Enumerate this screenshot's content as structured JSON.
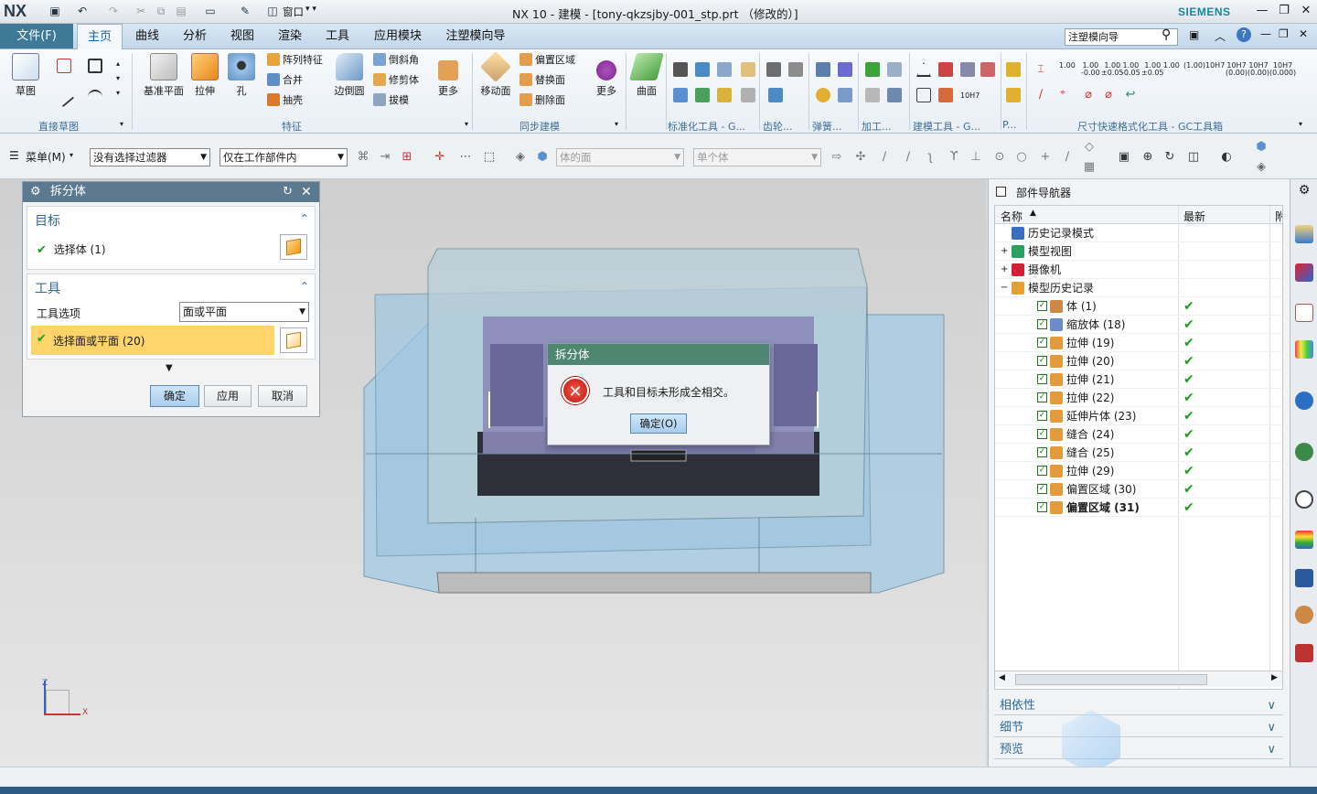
{
  "app": {
    "logo": "NX",
    "title": "NX 10 - 建模 - [tony-qkzsjby-001_stp.prt （修改的）]",
    "brand": "SIEMENS",
    "window_menu": "窗口"
  },
  "tabs": {
    "file": "文件(F)",
    "items": [
      "主页",
      "曲线",
      "分析",
      "视图",
      "渲染",
      "工具",
      "应用模块",
      "注塑模向导"
    ],
    "active": "主页"
  },
  "command_finder": "注塑模向导",
  "ribbon": {
    "sketch": "草图",
    "groups": [
      "直接草图",
      "特征",
      "同步建模",
      "标准化工具 - G...",
      "齿轮...",
      "弹簧...",
      "加工...",
      "建模工具 - G...",
      "P...",
      "尺寸快速格式化工具 - GC工具箱"
    ],
    "datum_plane": "基准平面",
    "extrude": "拉伸",
    "hole": "孔",
    "pattern": "阵列特征",
    "unite": "合并",
    "shell": "抽壳",
    "edge_blend": "边倒圆",
    "chamfer": "倒斜角",
    "trim_body": "修剪体",
    "draft": "拔模",
    "more": "更多",
    "move_face": "移动面",
    "offset_region": "偏置区域",
    "replace_face": "替换面",
    "delete_face": "删除面",
    "more2": "更多",
    "surface": "曲面",
    "gc_labels": [
      "1.00",
      "1.00\n-0.00",
      "1.00\n±0.05",
      "1.00\n-0.05",
      "1.00\n±0.05",
      "1.00",
      "(1.00)",
      "10H7",
      "10H7\n(0.00)",
      "10H7\n(0.00)",
      "10H7\n(0.000)"
    ],
    "h7": "10H7"
  },
  "selbar": {
    "menu": "菜单(M)",
    "filter": "没有选择过滤器",
    "scope": "仅在工作部件内",
    "face_rule": "体的面",
    "body_rule": "单个体"
  },
  "dialog": {
    "title": "拆分体",
    "target_title": "目标",
    "select_body": "选择体 (1)",
    "tool_title": "工具",
    "tool_option_label": "工具选项",
    "tool_option_value": "面或平面",
    "select_face": "选择面或平面 (20)",
    "ok": "确定",
    "apply": "应用",
    "cancel": "取消"
  },
  "error": {
    "title": "拆分体",
    "message": "工具和目标未形成全相交。",
    "ok": "确定(O)"
  },
  "navigator": {
    "title": "部件导航器",
    "col_name": "名称",
    "col_latest": "最新",
    "col_extra": "附",
    "rows": [
      {
        "label": "历史记录模式",
        "indent": 0,
        "check": false,
        "ok": false,
        "bold": false
      },
      {
        "label": "模型视图",
        "indent": 0,
        "check": false,
        "ok": false,
        "bold": false
      },
      {
        "label": "摄像机",
        "indent": 0,
        "check": false,
        "ok": false,
        "bold": false
      },
      {
        "label": "模型历史记录",
        "indent": 0,
        "check": false,
        "ok": false,
        "bold": false
      },
      {
        "label": "体 (1)",
        "indent": 1,
        "check": true,
        "ok": true,
        "bold": false
      },
      {
        "label": "缩放体 (18)",
        "indent": 1,
        "check": true,
        "ok": true,
        "bold": false
      },
      {
        "label": "拉伸 (19)",
        "indent": 1,
        "check": true,
        "ok": true,
        "bold": false
      },
      {
        "label": "拉伸 (20)",
        "indent": 1,
        "check": true,
        "ok": true,
        "bold": false
      },
      {
        "label": "拉伸 (21)",
        "indent": 1,
        "check": true,
        "ok": true,
        "bold": false
      },
      {
        "label": "拉伸 (22)",
        "indent": 1,
        "check": true,
        "ok": true,
        "bold": false
      },
      {
        "label": "延伸片体 (23)",
        "indent": 1,
        "check": true,
        "ok": true,
        "bold": false
      },
      {
        "label": "缝合 (24)",
        "indent": 1,
        "check": true,
        "ok": true,
        "bold": false
      },
      {
        "label": "缝合 (25)",
        "indent": 1,
        "check": true,
        "ok": true,
        "bold": false
      },
      {
        "label": "拉伸 (29)",
        "indent": 1,
        "check": true,
        "ok": true,
        "bold": false
      },
      {
        "label": "偏置区域 (30)",
        "indent": 1,
        "check": true,
        "ok": true,
        "bold": false
      },
      {
        "label": "偏置区域 (31)",
        "indent": 1,
        "check": true,
        "ok": true,
        "bold": true
      }
    ],
    "panels": [
      "相依性",
      "细节",
      "预览"
    ]
  },
  "axes": {
    "z": "Z",
    "x": "X"
  }
}
